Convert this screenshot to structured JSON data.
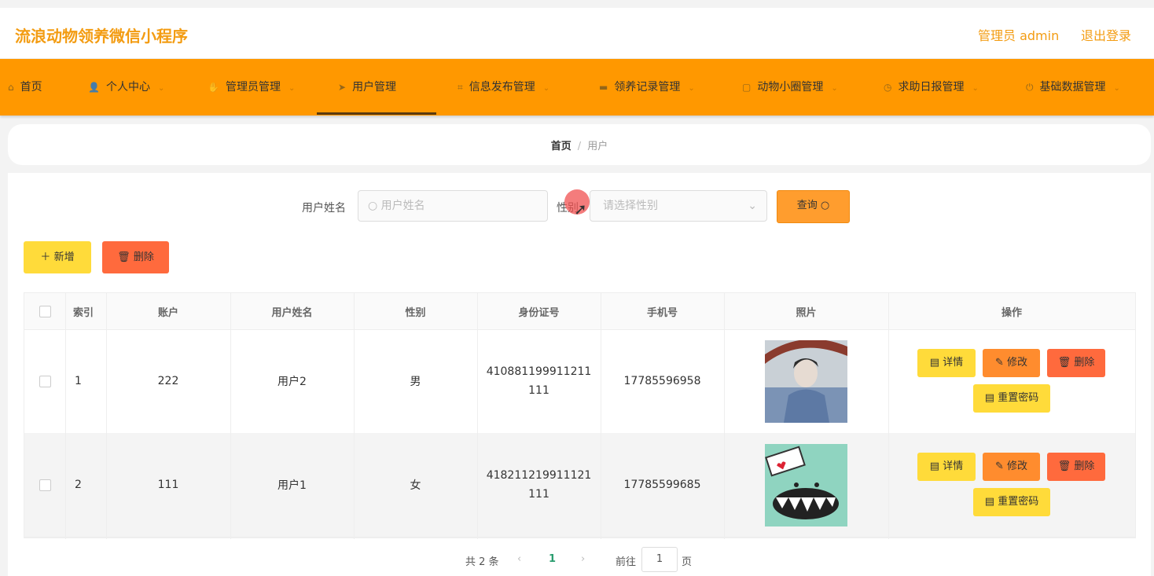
{
  "app": {
    "title": "流浪动物领养微信小程序",
    "admin_label": "管理员 admin",
    "logout": "退出登录"
  },
  "nav": [
    {
      "label": "首页",
      "icon": "home-icon",
      "glyph": "⌂",
      "chev": false
    },
    {
      "label": "个人中心",
      "icon": "user-icon",
      "glyph": "👤",
      "chev": true
    },
    {
      "label": "管理员管理",
      "icon": "thumb-icon",
      "glyph": "✋",
      "chev": true
    },
    {
      "label": "用户管理",
      "icon": "send-icon",
      "glyph": "➤",
      "chev": false
    },
    {
      "label": "信息发布管理",
      "icon": "crop-icon",
      "glyph": "⌗",
      "chev": true
    },
    {
      "label": "领养记录管理",
      "icon": "chat-icon",
      "glyph": "▬",
      "chev": true
    },
    {
      "label": "动物小圈管理",
      "icon": "picture-icon",
      "glyph": "▢",
      "chev": true
    },
    {
      "label": "求助日报管理",
      "icon": "clock-icon",
      "glyph": "◷",
      "chev": true
    },
    {
      "label": "基础数据管理",
      "icon": "power-icon",
      "glyph": "⏻",
      "chev": true
    }
  ],
  "breadcrumb": {
    "home": "首页",
    "sep": "/",
    "current": "用户"
  },
  "search": {
    "name_label": "用户姓名",
    "name_placeholder": "用户姓名",
    "gender_label": "性别",
    "gender_placeholder": "请选择性别",
    "query_button": "查询"
  },
  "toolbar": {
    "add": "新增",
    "delete": "删除"
  },
  "table": {
    "headers": [
      "索引",
      "账户",
      "用户姓名",
      "性别",
      "身份证号",
      "手机号",
      "照片",
      "操作"
    ],
    "rows": [
      {
        "index": "1",
        "account": "222",
        "name": "用户2",
        "gender": "男",
        "id_card": "410881199911211111",
        "phone": "17785596958",
        "photo": "portrait-photo"
      },
      {
        "index": "2",
        "account": "111",
        "name": "用户1",
        "gender": "女",
        "id_card": "418211219911121111",
        "phone": "17785599685",
        "photo": "xmas-monster-photo"
      }
    ],
    "actions": {
      "detail": "详情",
      "edit": "修改",
      "delete": "删除",
      "reset": "重置密码"
    }
  },
  "pagination": {
    "total": "共 2 条",
    "current": "1",
    "goto_label": "前往",
    "goto_value": "1",
    "page_unit": "页"
  },
  "colors": {
    "accent": "#ff9800",
    "brand_text": "#f39c12",
    "yellow": "#ffdb3a",
    "red": "#ff6a3d"
  }
}
